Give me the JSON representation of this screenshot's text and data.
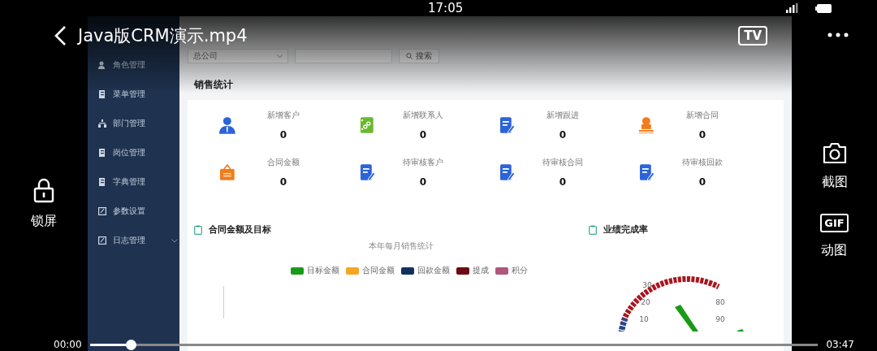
{
  "status_bar": {
    "time": "17:05"
  },
  "player": {
    "title": "Java版CRM演示.mp4",
    "tv_label": "TV",
    "side_left": [
      {
        "kind": "lock",
        "label": "锁屏"
      }
    ],
    "side_right": [
      {
        "kind": "camera",
        "label": "截图"
      },
      {
        "kind": "gif",
        "label": "动图",
        "badge": "GIF"
      }
    ],
    "elapsed": "00:00",
    "duration": "03:47",
    "level": 0.05
  },
  "app": {
    "sidebar": {
      "items": [
        {
          "kind": "role",
          "label": "角色管理",
          "expandable": false
        },
        {
          "kind": "menu",
          "label": "菜单管理",
          "expandable": false
        },
        {
          "kind": "dept",
          "label": "部门管理",
          "expandable": false
        },
        {
          "kind": "post",
          "label": "岗位管理",
          "expandable": false
        },
        {
          "kind": "dict",
          "label": "字典管理",
          "expandable": false
        },
        {
          "kind": "param",
          "label": "参数设置",
          "expandable": false
        },
        {
          "kind": "log",
          "label": "日志管理",
          "expandable": true
        }
      ]
    },
    "filters": {
      "company": "总公司",
      "search_button": "搜索"
    },
    "section_title": "销售统计",
    "stats": [
      {
        "kind": "person",
        "label": "新增客户",
        "value": "0"
      },
      {
        "kind": "contact",
        "label": "新增联系人",
        "value": "0"
      },
      {
        "kind": "edit",
        "label": "新增跟进",
        "value": "0"
      },
      {
        "kind": "stamp",
        "label": "新增合同",
        "value": "0"
      },
      {
        "kind": "bag",
        "label": "合同金额",
        "value": "0"
      },
      {
        "kind": "edit",
        "label": "待审核客户",
        "value": "0"
      },
      {
        "kind": "edit",
        "label": "待审核合同",
        "value": "0"
      },
      {
        "kind": "edit",
        "label": "待审核回款",
        "value": "0"
      }
    ],
    "contract_card": {
      "title": "合同金额及目标",
      "subtitle": "本年每月销售统计",
      "legend": [
        {
          "name": "目标金额",
          "color": "#1a9a1a"
        },
        {
          "name": "合同金额",
          "color": "#f5a623"
        },
        {
          "name": "回款金额",
          "color": "#12305e"
        },
        {
          "name": "提成",
          "color": "#6b0a10"
        },
        {
          "name": "积分",
          "color": "#b0577c"
        }
      ]
    },
    "gauge_card": {
      "title": "业绩完成率",
      "left_ticks": [
        "30",
        "20",
        "10"
      ],
      "right_ticks": [
        "80",
        "90"
      ]
    }
  }
}
